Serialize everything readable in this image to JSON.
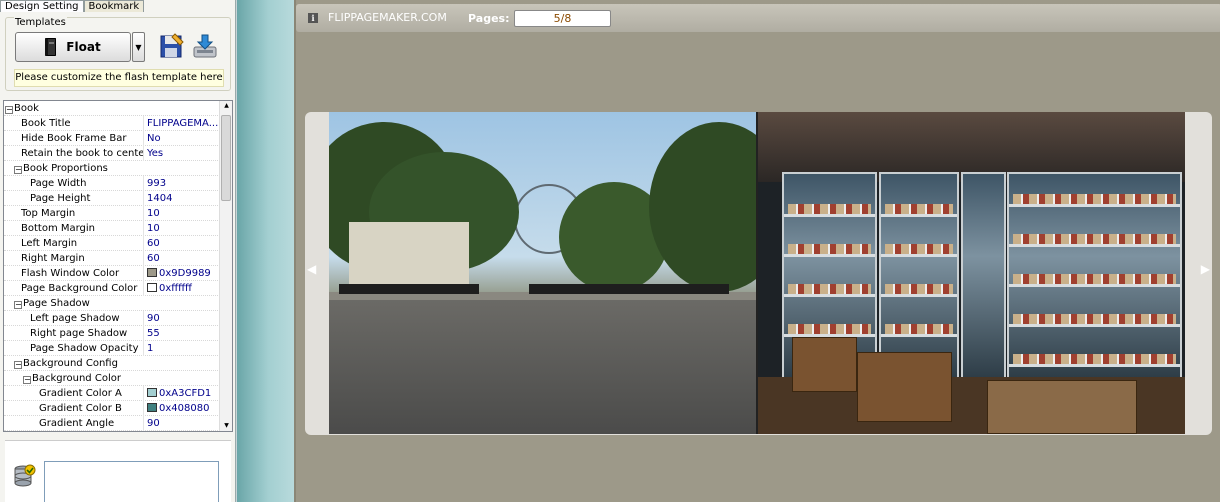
{
  "tabs": [
    {
      "label": "Design Setting",
      "active": true
    },
    {
      "label": "Bookmark",
      "active": false
    }
  ],
  "templates": {
    "legend": "Templates",
    "template_name": "Float",
    "note": "Please customize the flash template here",
    "icons": [
      "book-icon",
      "chevron-down-icon",
      "save-template-icon",
      "import-template-icon"
    ]
  },
  "properties": [
    {
      "level": 0,
      "category": true,
      "name": "Book"
    },
    {
      "level": 1,
      "name": "Book Title",
      "value": "FLIPPAGEMA..."
    },
    {
      "level": 1,
      "name": "Hide Book Frame Bar",
      "value": "No"
    },
    {
      "level": 1,
      "name": "Retain the book to center",
      "value": "Yes"
    },
    {
      "level": 1,
      "category": true,
      "name": "Book Proportions"
    },
    {
      "level": 2,
      "name": "Page Width",
      "value": "993"
    },
    {
      "level": 2,
      "name": "Page Height",
      "value": "1404"
    },
    {
      "level": 1,
      "name": "Top Margin",
      "value": "10"
    },
    {
      "level": 1,
      "name": "Bottom Margin",
      "value": "10"
    },
    {
      "level": 1,
      "name": "Left Margin",
      "value": "60"
    },
    {
      "level": 1,
      "name": "Right Margin",
      "value": "60"
    },
    {
      "level": 1,
      "name": "Flash Window Color",
      "value": "0x9D9989",
      "swatch": "#9D9989"
    },
    {
      "level": 1,
      "name": "Page Background Color",
      "value": "0xffffff",
      "swatch": "#ffffff"
    },
    {
      "level": 1,
      "category": true,
      "name": "Page Shadow"
    },
    {
      "level": 2,
      "name": "Left page Shadow",
      "value": "90"
    },
    {
      "level": 2,
      "name": "Right page Shadow",
      "value": "55"
    },
    {
      "level": 2,
      "name": "Page Shadow Opacity",
      "value": "1"
    },
    {
      "level": 1,
      "category": true,
      "name": "Background Config"
    },
    {
      "level": 2,
      "category": true,
      "name": "Background Color"
    },
    {
      "level": 3,
      "name": "Gradient Color A",
      "value": "0xA3CFD1",
      "swatch": "#A3CFD1"
    },
    {
      "level": 3,
      "name": "Gradient Color B",
      "value": "0x408080",
      "swatch": "#408080"
    },
    {
      "level": 3,
      "name": "Gradient Angle",
      "value": "90"
    }
  ],
  "preview": {
    "brand": "FLIPPAGEMAKER.COM",
    "pages_label": "Pages:",
    "pages_value": "5/8",
    "prev_arrow": "◀",
    "next_arrow": "▶",
    "window_color": "#9d9989"
  }
}
